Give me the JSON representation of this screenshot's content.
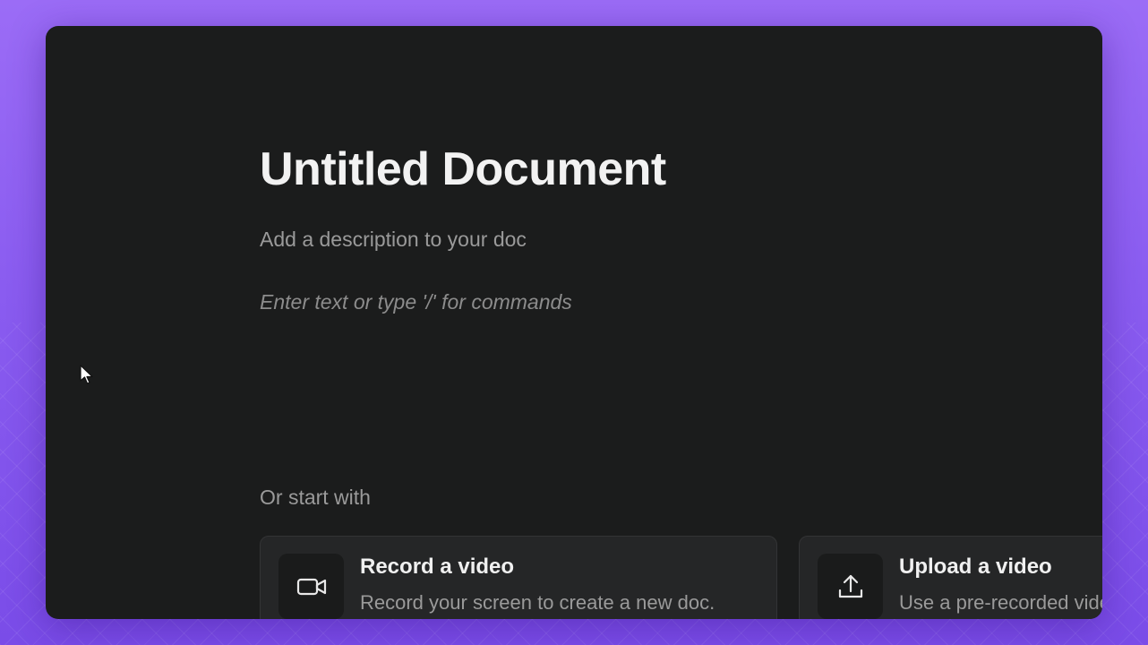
{
  "document": {
    "title": "Untitled Document",
    "description_placeholder": "Add a description to your doc",
    "body_placeholder": "Enter text or type '/' for commands"
  },
  "start_options": {
    "label": "Or start with",
    "cards": [
      {
        "title": "Record a video",
        "description": "Record your screen to create a new doc.",
        "icon": "video-camera-icon"
      },
      {
        "title": "Upload a video",
        "description": "Use a pre-recorded video",
        "icon": "upload-icon"
      }
    ]
  },
  "colors": {
    "background_purple": "#8a5cf0",
    "window_background": "#1b1c1c",
    "card_background": "#252627"
  }
}
